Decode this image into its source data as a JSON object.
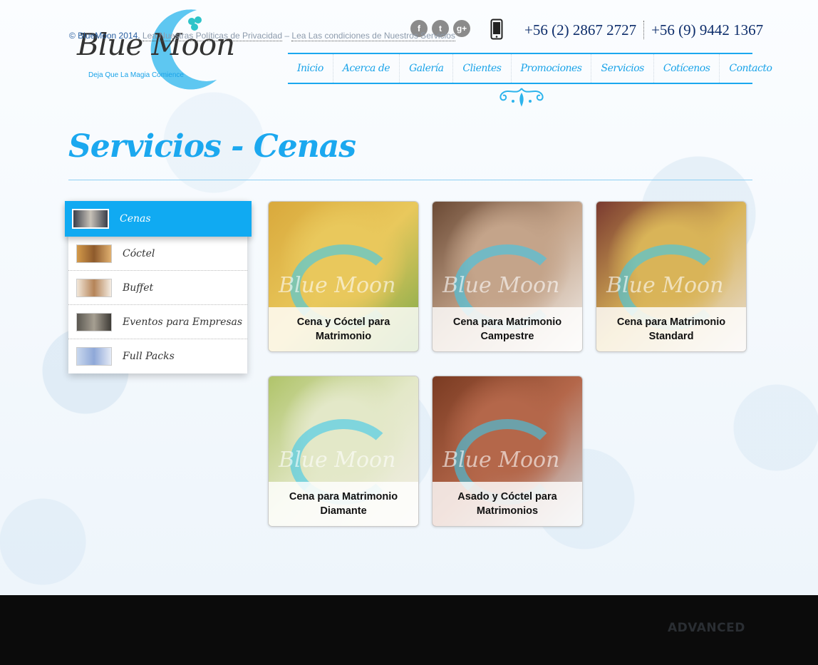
{
  "brand": {
    "logo_text": "Blue Moon",
    "tagline": "Deja Que La Magia Comience"
  },
  "header": {
    "social": [
      {
        "icon": "facebook-icon",
        "glyph": "f"
      },
      {
        "icon": "twitter-icon",
        "glyph": "t"
      },
      {
        "icon": "google-plus-icon",
        "glyph": "g+"
      }
    ],
    "phone_1": "+56 (2) 2867 2727",
    "phone_2": "+56 (9) 9442 1367"
  },
  "nav": {
    "items": [
      "Inicio",
      "Acerca de",
      "Galería",
      "Clientes",
      "Promociones",
      "Servicios",
      "Cotícenos",
      "Contacto"
    ]
  },
  "page": {
    "title": "Servicios - Cenas"
  },
  "sidebar": {
    "items": [
      {
        "label": "Cenas",
        "active": true
      },
      {
        "label": "Cóctel",
        "active": false
      },
      {
        "label": "Buffet",
        "active": false
      },
      {
        "label": "Eventos para Empresas",
        "active": false
      },
      {
        "label": "Full Packs",
        "active": false
      }
    ]
  },
  "cards": [
    {
      "title": "Cena y Cóctel para Matrimonio",
      "colors": [
        "#d9a93c",
        "#e9c85c",
        "#7aa94a"
      ]
    },
    {
      "title": "Cena para Matrimonio Campestre",
      "colors": [
        "#6b4a35",
        "#c4a48a",
        "#f0ece8"
      ]
    },
    {
      "title": "Cena para Matrimonio Standard",
      "colors": [
        "#7a3a30",
        "#d9b458",
        "#e7ddd6"
      ]
    },
    {
      "title": "Cena para Matrimonio Diamante",
      "colors": [
        "#b0c46a",
        "#e3e8c8",
        "#f1ede4"
      ]
    },
    {
      "title": "Asado y Cóctel para Matrimonios",
      "colors": [
        "#7a3b22",
        "#b4674a",
        "#cfd4d8"
      ]
    }
  ],
  "watermark": "Blue Moon",
  "footer": {
    "copyright": "© BlueMoon 2014.",
    "privacy_link": "Lea Nuestras Políticas de Privacidad",
    "separator": "–",
    "terms_link": "Lea Las condiciones de Nuestros Servicios",
    "credit": "ADVANCED"
  },
  "colors": {
    "accent": "#1ba8ef",
    "footer_bg": "#0b0b0b",
    "phone_text": "#0d2d6b"
  }
}
